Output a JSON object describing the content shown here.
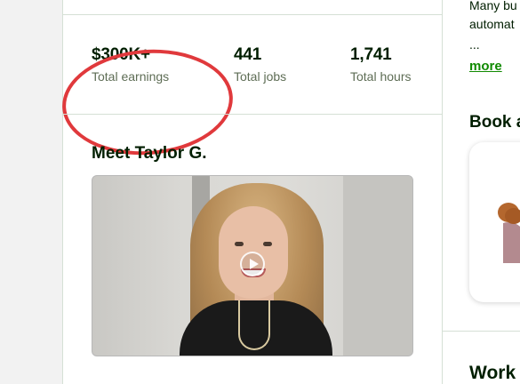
{
  "stats": [
    {
      "value": "$300K+",
      "label": "Total earnings"
    },
    {
      "value": "441",
      "label": "Total jobs"
    },
    {
      "value": "1,741",
      "label": "Total hours"
    }
  ],
  "video_section": {
    "title": "Meet Taylor G."
  },
  "sidebar": {
    "line1": "Many bu",
    "line2": "automat",
    "ellipsis": "...",
    "more_link": "more",
    "heading": "Book a",
    "heading2": "Work"
  },
  "colors": {
    "accent_green": "#108a00",
    "highlight_red": "#e0393c",
    "text_dark": "#001e00",
    "text_muted": "#5e6d55"
  }
}
